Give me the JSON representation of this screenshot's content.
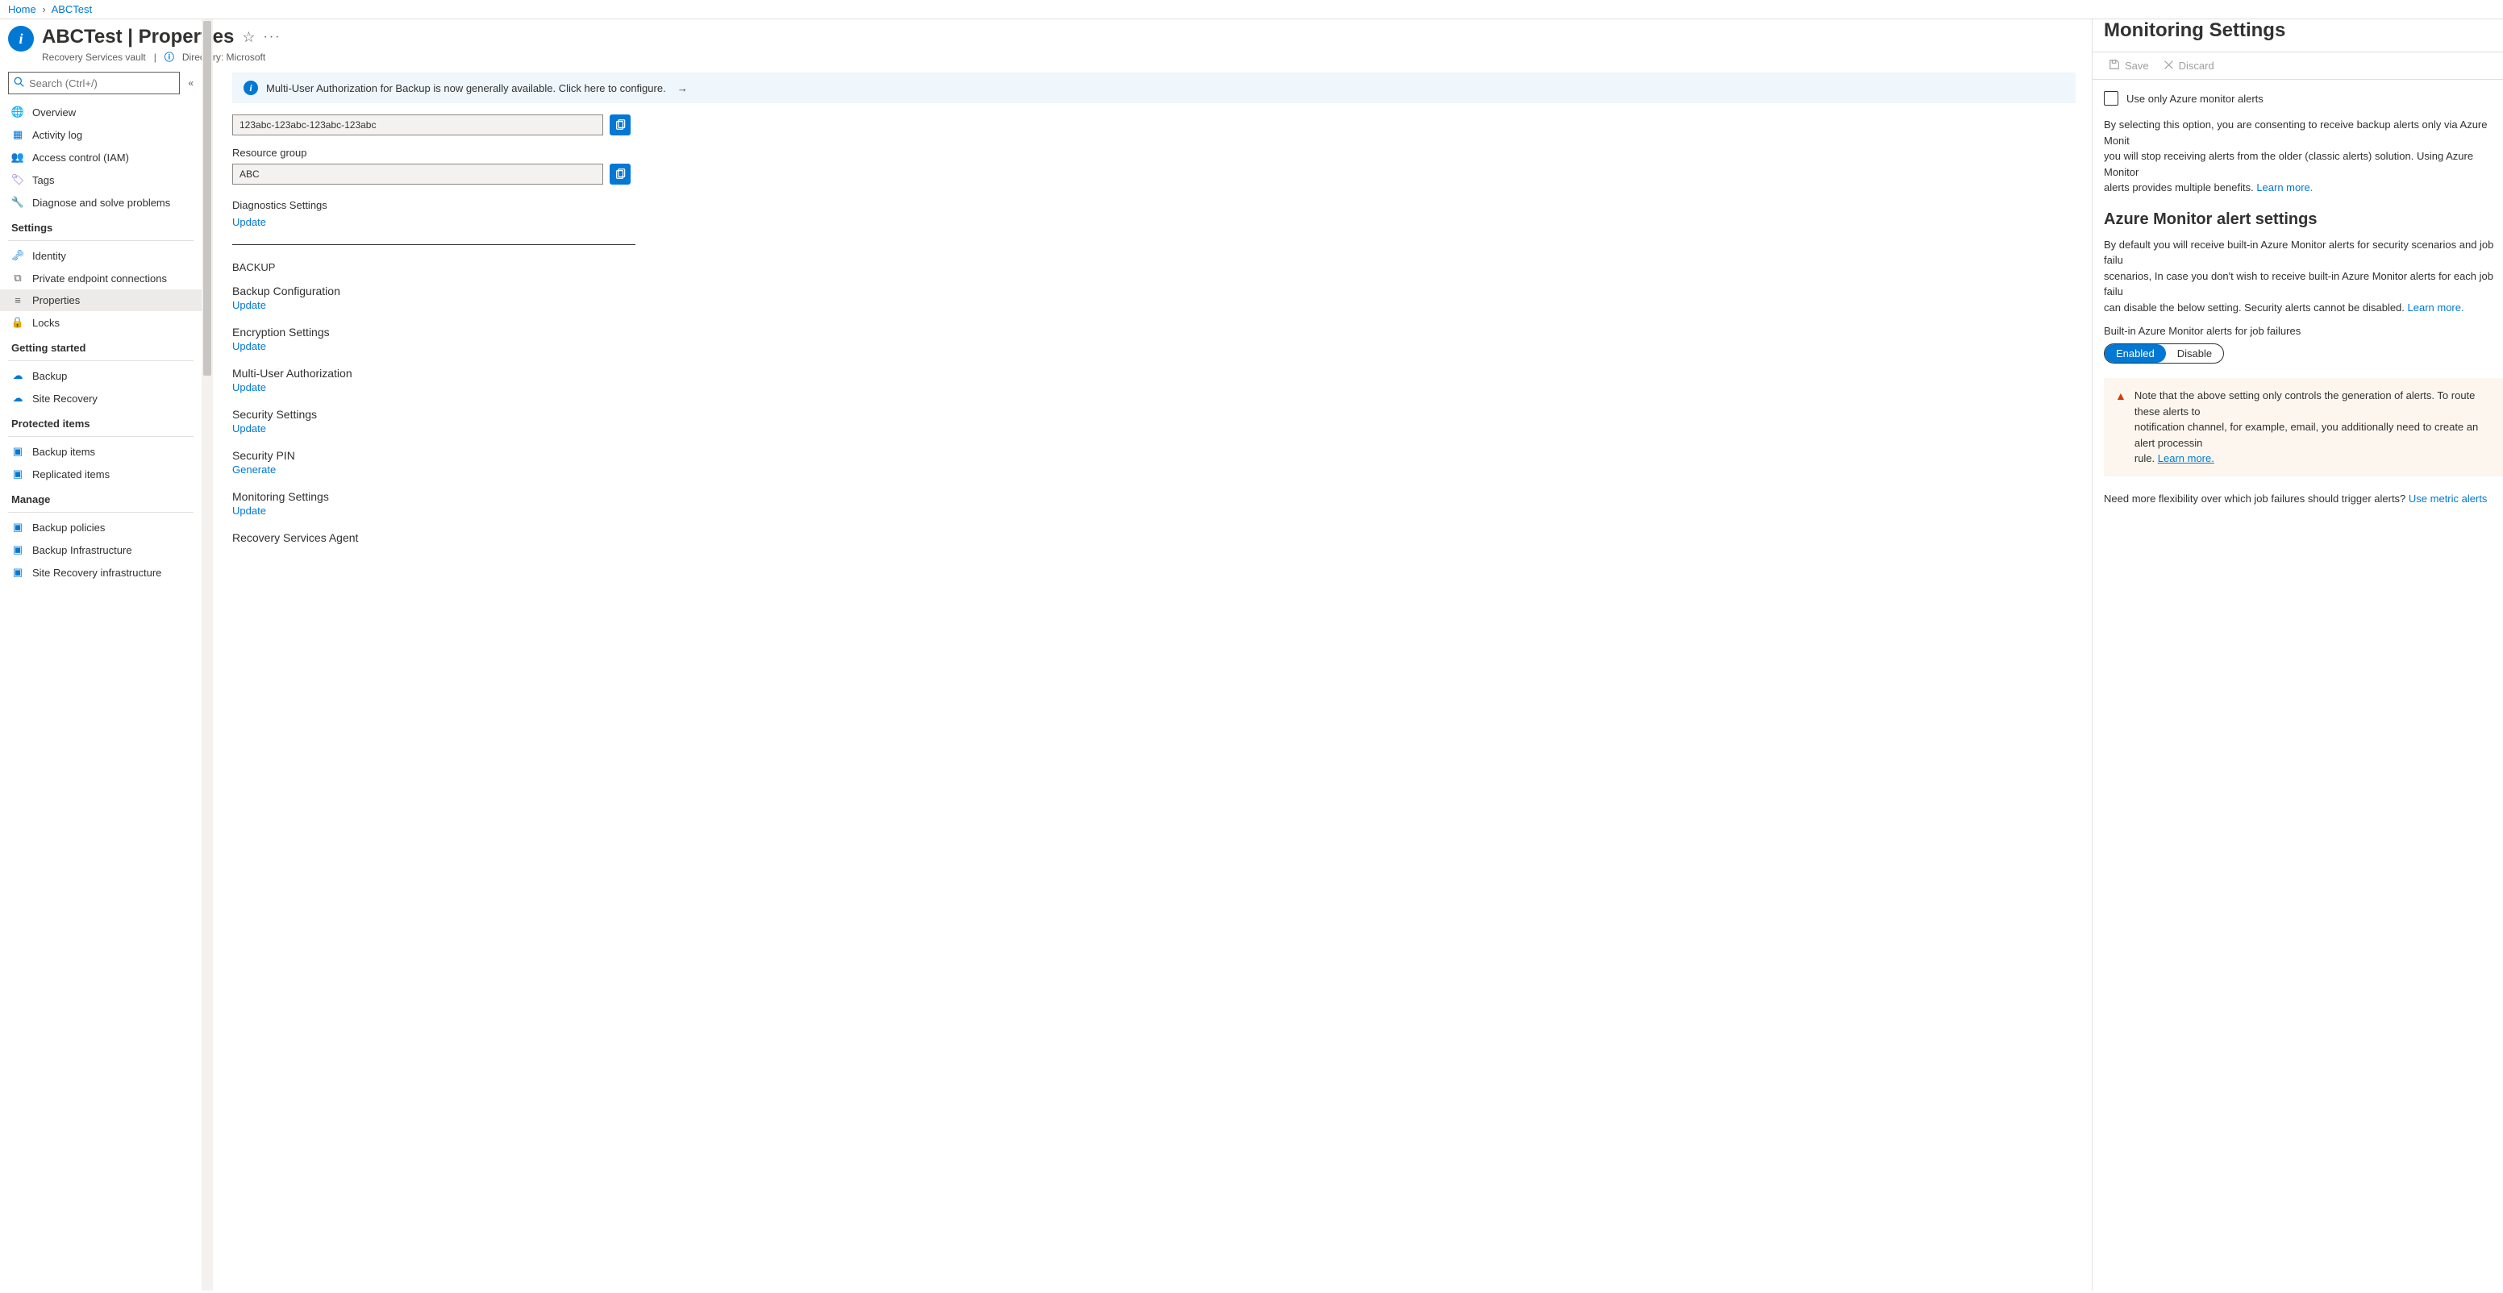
{
  "breadcrumb": {
    "home": "Home",
    "current": "ABCTest"
  },
  "resource": {
    "name": "ABCTest",
    "page": "Properties",
    "type": "Recovery Services vault",
    "directory_label": "Directory: ",
    "directory_value": "Microsoft"
  },
  "search": {
    "placeholder": "Search (Ctrl+/)"
  },
  "sidebar": {
    "top_items": [
      {
        "icon": "globe",
        "label": "Overview"
      },
      {
        "icon": "log",
        "label": "Activity log"
      },
      {
        "icon": "iam",
        "label": "Access control (IAM)"
      },
      {
        "icon": "tag",
        "label": "Tags"
      },
      {
        "icon": "wrench",
        "label": "Diagnose and solve problems"
      }
    ],
    "groups": [
      {
        "label": "Settings",
        "items": [
          {
            "icon": "key",
            "label": "Identity"
          },
          {
            "icon": "endpoint",
            "label": "Private endpoint connections"
          },
          {
            "icon": "props",
            "label": "Properties",
            "selected": true
          },
          {
            "icon": "lock",
            "label": "Locks"
          }
        ]
      },
      {
        "label": "Getting started",
        "items": [
          {
            "icon": "cloud",
            "label": "Backup"
          },
          {
            "icon": "cloud",
            "label": "Site Recovery"
          }
        ]
      },
      {
        "label": "Protected items",
        "items": [
          {
            "icon": "grid",
            "label": "Backup items"
          },
          {
            "icon": "grid",
            "label": "Replicated items"
          }
        ]
      },
      {
        "label": "Manage",
        "items": [
          {
            "icon": "grid",
            "label": "Backup policies"
          },
          {
            "icon": "grid",
            "label": "Backup Infrastructure"
          },
          {
            "icon": "grid",
            "label": "Site Recovery infrastructure"
          }
        ]
      }
    ]
  },
  "content": {
    "info_bar": "Multi-User Authorization for Backup is now generally available. Click here to configure.",
    "id_value": "123abc-123abc-123abc-123abc",
    "rg_label": "Resource group",
    "rg_value": "ABC",
    "diag_label": "Diagnostics Settings",
    "update": "Update",
    "generate": "Generate",
    "backup_section": "BACKUP",
    "blocks": [
      {
        "label": "Backup Configuration",
        "action": "Update"
      },
      {
        "label": "Encryption Settings",
        "action": "Update"
      },
      {
        "label": "Multi-User Authorization",
        "action": "Update"
      },
      {
        "label": "Security Settings",
        "action": "Update"
      },
      {
        "label": "Security PIN",
        "action": "Generate"
      },
      {
        "label": "Monitoring Settings",
        "action": "Update"
      },
      {
        "label": "Recovery Services Agent",
        "action": ""
      }
    ]
  },
  "panel": {
    "title": "Monitoring Settings",
    "save": "Save",
    "discard": "Discard",
    "checkbox_label": "Use only Azure monitor alerts",
    "p1a": "By selecting this option, you are consenting to receive backup alerts only via Azure Monit",
    "p1b": "you will stop receiving alerts from the older (classic alerts) solution. Using Azure Monitor ",
    "p1c": "alerts provides multiple benefits. ",
    "learn_more": "Learn more.",
    "h2": "Azure Monitor alert settings",
    "p2a": "By default you will receive built-in Azure Monitor alerts for security scenarios and job failu",
    "p2b": "scenarios, In case you don't wish to receive built-in Azure Monitor alerts for each job failu",
    "p2c": "can disable the below setting. Security alerts cannot be disabled. ",
    "toggle_label": "Built-in Azure Monitor alerts for job failures",
    "enabled": "Enabled",
    "disable": "Disable",
    "note_a": "Note that the above setting only controls the generation of alerts. To route these alerts to",
    "note_b": "notification channel, for example, email, you additionally need to create an alert processin",
    "note_c": "rule. ",
    "flex_text": "Need more flexibility over which job failures should trigger alerts? ",
    "metric_link": "Use metric alerts"
  }
}
